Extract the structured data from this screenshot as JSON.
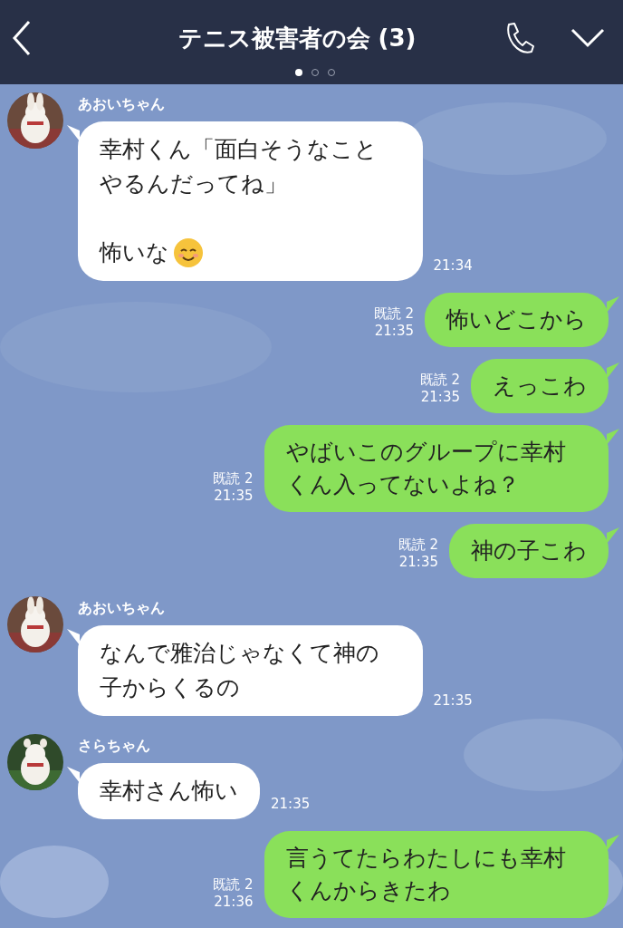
{
  "header": {
    "title": "テニス被害者の会 (3)",
    "pages": [
      {
        "selected": true
      },
      {
        "selected": false
      },
      {
        "selected": false
      }
    ]
  },
  "messages": [
    {
      "kind": "received",
      "sender": "あおいちゃん",
      "paragraphs": [
        "幸村くん「面白そうなことやるんだってね」",
        "怖いな"
      ],
      "trailing_emoji": true,
      "time": "21:34"
    },
    {
      "kind": "sent",
      "paragraphs": [
        "怖いどこから"
      ],
      "read": "既読 2",
      "time": "21:35"
    },
    {
      "kind": "sent",
      "paragraphs": [
        "えっこわ"
      ],
      "read": "既読 2",
      "time": "21:35"
    },
    {
      "kind": "sent",
      "paragraphs": [
        "やばいこのグループに幸村くん入ってないよね？"
      ],
      "read": "既読 2",
      "time": "21:35"
    },
    {
      "kind": "sent",
      "paragraphs": [
        "神の子こわ"
      ],
      "read": "既読 2",
      "time": "21:35"
    },
    {
      "kind": "received",
      "sender": "あおいちゃん",
      "paragraphs": [
        "なんで雅治じゃなくて神の子からくるの"
      ],
      "trailing_emoji": false,
      "time": "21:35"
    },
    {
      "kind": "received",
      "sender": "さらちゃん",
      "paragraphs": [
        "幸村さん怖い"
      ],
      "trailing_emoji": false,
      "time": "21:35"
    },
    {
      "kind": "sent",
      "paragraphs": [
        "言うてたらわたしにも幸村くんからきたわ"
      ],
      "read": "既読 2",
      "time": "21:36"
    }
  ]
}
